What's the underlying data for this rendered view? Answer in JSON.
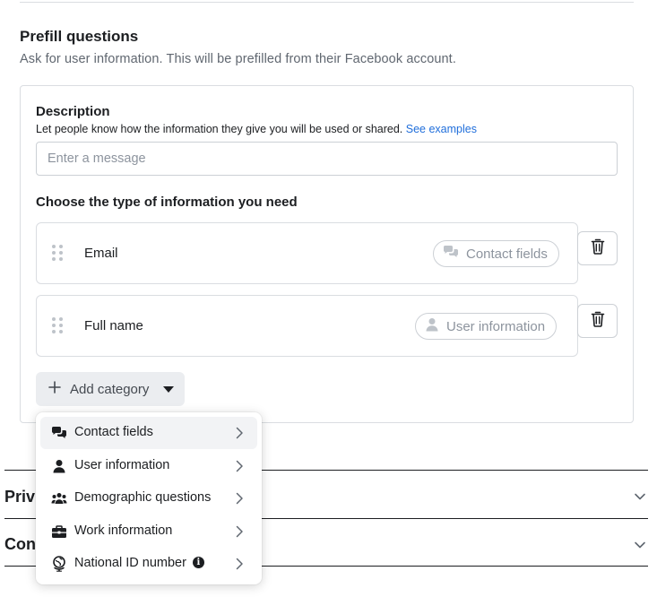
{
  "section": {
    "title": "Prefill questions",
    "subtitle": "Ask for user information. This will be prefilled from their Facebook account."
  },
  "description": {
    "title": "Description",
    "help_text": "Let people know how the information they give you will be used or shared.",
    "help_link": "See examples",
    "input_value": "",
    "input_placeholder": "Enter a message"
  },
  "choose_title": "Choose the type of information you need",
  "fields": [
    {
      "label": "Email",
      "category": "Contact fields",
      "category_icon": "chat-bubbles-icon"
    },
    {
      "label": "Full name",
      "category": "User information",
      "category_icon": "person-icon"
    }
  ],
  "add_category": {
    "label": "Add category",
    "icon": "plus-icon"
  },
  "accordions": [
    {
      "title": "Priv"
    },
    {
      "title": "Con"
    }
  ],
  "menu": {
    "items": [
      {
        "label": "Contact fields",
        "icon": "chat-bubbles-icon",
        "active": true
      },
      {
        "label": "User information",
        "icon": "person-icon",
        "active": false
      },
      {
        "label": "Demographic questions",
        "icon": "people-group-icon",
        "active": false
      },
      {
        "label": "Work information",
        "icon": "briefcase-icon",
        "active": false
      },
      {
        "label": "National ID number",
        "icon": "globe-pin-icon",
        "active": false,
        "info_icon": "i"
      }
    ]
  },
  "colors": {
    "link": "#216fdb",
    "text": "#1c1e21",
    "muted": "#606770",
    "border": "#dadde1",
    "button_bg": "#ebedf0",
    "menu_active_bg": "#f2f3f5"
  }
}
